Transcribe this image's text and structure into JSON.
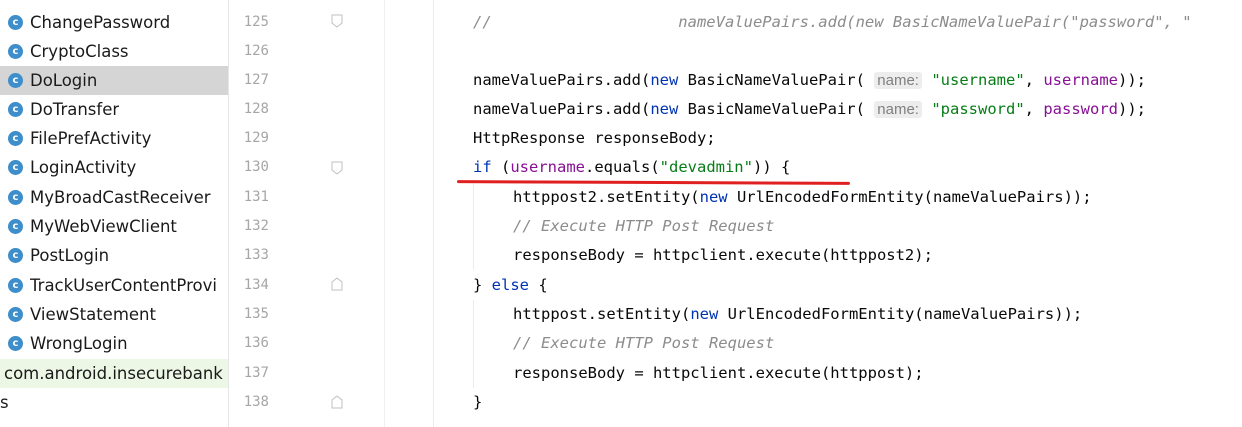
{
  "tree": {
    "items": [
      {
        "icon": "c",
        "label": "ChangePassword"
      },
      {
        "icon": "c",
        "label": "CryptoClass"
      },
      {
        "icon": "c",
        "label": "DoLogin",
        "selected": true
      },
      {
        "icon": "c",
        "label": "DoTransfer"
      },
      {
        "icon": "c",
        "label": "FilePrefActivity"
      },
      {
        "icon": "c",
        "label": "LoginActivity"
      },
      {
        "icon": "c",
        "label": "MyBroadCastReceiver"
      },
      {
        "icon": "c",
        "label": "MyWebViewClient"
      },
      {
        "icon": "c",
        "label": "PostLogin"
      },
      {
        "icon": "c",
        "label": "TrackUserContentProvi"
      },
      {
        "icon": "c",
        "label": "ViewStatement"
      },
      {
        "icon": "c",
        "label": "WrongLogin"
      }
    ],
    "package_label": "com.android.insecurebank",
    "bottom_label": "s"
  },
  "gutter": {
    "line_numbers": [
      "125",
      "126",
      "127",
      "128",
      "129",
      "130",
      "131",
      "132",
      "133",
      "134",
      "135",
      "136",
      "137",
      "138"
    ]
  },
  "code": {
    "comment_top": "//                    nameValuePairs.add(new BasicNameValuePair(\"password\", \"",
    "l127_a": "nameValuePairs.add(",
    "kw_new": "new",
    "l127_b": " BasicNameValuePair( ",
    "hint_name": "name:",
    "str_username": "\"username\"",
    "sep": ", ",
    "fld_username": "username",
    "close": "));",
    "str_password": "\"password\"",
    "fld_password": "password",
    "l129": "HttpResponse responseBody;",
    "kw_if": "if",
    "l130_a": " (",
    "l130_b": ".equals(",
    "str_devadmin": "\"devadmin\"",
    "l130_c": ")) {",
    "l131_a": "httppost2.setEntity(",
    "l131_b": " UrlEncodedFormEntity(nameValuePairs));",
    "comment_exec": "// Execute HTTP Post Request",
    "l133": "responseBody = httpclient.execute(httppost2);",
    "l134_a": "} ",
    "kw_else": "else",
    "l134_b": " {",
    "l135_a": "httppost.setEntity(",
    "l137": "responseBody = httpclient.execute(httppost);",
    "l138": "}"
  },
  "colors": {
    "keyword": "#0033b3",
    "string": "#067d17",
    "field": "#871094",
    "comment": "#8c8c8c",
    "underline": "#e02020",
    "class_icon": "#3d8eca"
  }
}
